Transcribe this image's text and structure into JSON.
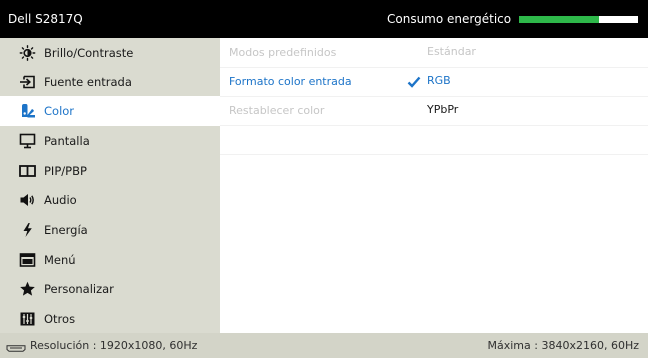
{
  "title_bar": {
    "model": "Dell S2817Q",
    "energy_label": "Consumo energético",
    "energy_level_fraction": 0.67,
    "energy_color": "#2eb84a"
  },
  "sidebar": {
    "items": [
      {
        "label": "Brillo/Contraste",
        "icon": "brightness-icon"
      },
      {
        "label": "Fuente entrada",
        "icon": "input-source-icon"
      },
      {
        "label": "Color",
        "icon": "color-icon",
        "selected": true
      },
      {
        "label": "Pantalla",
        "icon": "display-icon"
      },
      {
        "label": "PIP/PBP",
        "icon": "pip-pbp-icon"
      },
      {
        "label": "Audio",
        "icon": "audio-icon"
      },
      {
        "label": "Energía",
        "icon": "energy-icon"
      },
      {
        "label": "Menú",
        "icon": "menu-icon"
      },
      {
        "label": "Personalizar",
        "icon": "star-icon"
      },
      {
        "label": "Otros",
        "icon": "others-icon"
      }
    ]
  },
  "content": {
    "rows": [
      {
        "label": "Modos predefinidos",
        "value": "Estándar"
      },
      {
        "label": "Formato color entrada",
        "value": "RGB",
        "checked": true
      },
      {
        "label": "Restablecer color",
        "value": "YPbPr"
      }
    ]
  },
  "footer": {
    "resolution": "Resolución : 1920x1080, 60Hz",
    "maximum": "Máxima : 3840x2160, 60Hz"
  },
  "accent_color": "#1d74c8"
}
